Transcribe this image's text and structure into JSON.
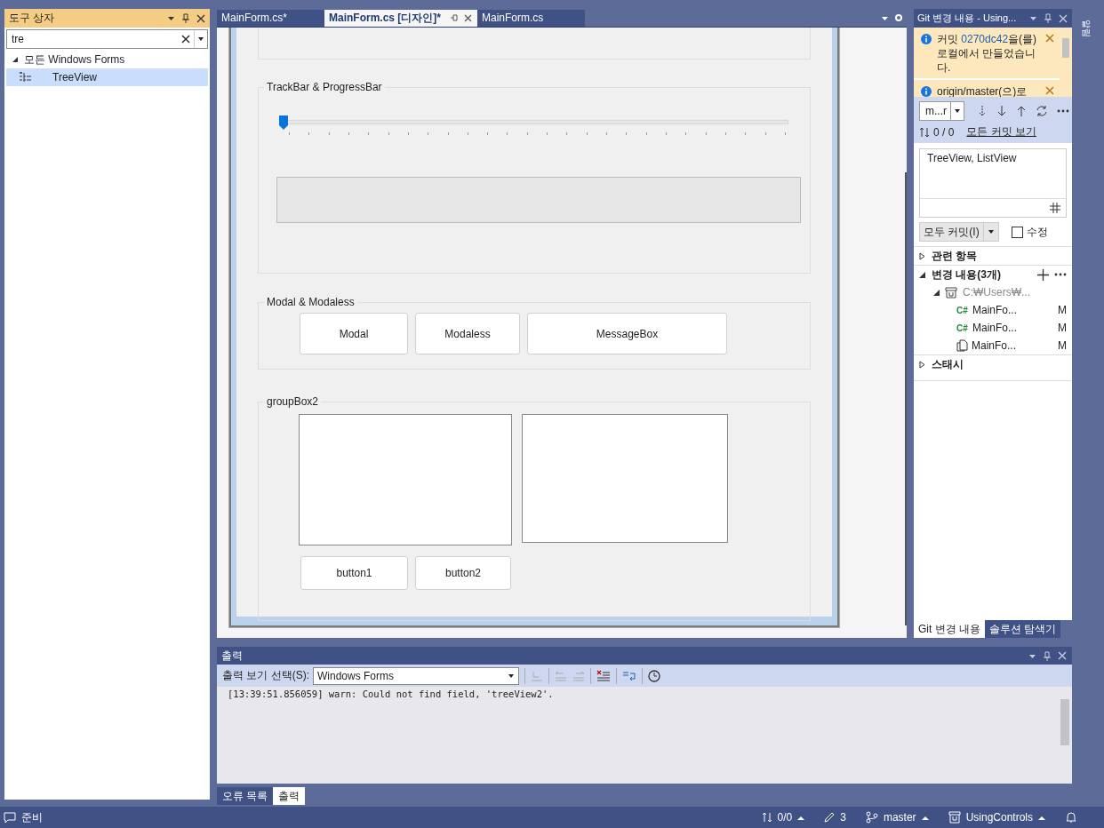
{
  "toolbox": {
    "title": "도구 상자",
    "search": {
      "value": "tre"
    },
    "tree": [
      {
        "label": "모든 Windows Forms",
        "expanded": true,
        "selected": false,
        "children": [
          {
            "label": "TreeView",
            "selected": true
          }
        ]
      }
    ]
  },
  "doc_tabs": [
    {
      "label": "MainForm.cs*",
      "selected": false
    },
    {
      "label": "MainForm.cs [디자인]*",
      "selected": true
    },
    {
      "label": "MainForm.cs",
      "selected": false
    }
  ],
  "designer": {
    "groups": [
      {
        "kind": "blank"
      },
      {
        "kind": "trackbar",
        "title": "TrackBar & ProgressBar",
        "trackbar": {
          "level": 0
        },
        "progress": {
          "level": 0
        }
      },
      {
        "kind": "buttons",
        "title": "Modal & Modaless",
        "buttons": [
          "Modal",
          "Modaless",
          "MessageBox"
        ]
      },
      {
        "kind": "lists",
        "title": "groupBox2",
        "buttons": [
          "button1",
          "button2"
        ]
      }
    ]
  },
  "git": {
    "title": "Git 변경 내용 - Using...",
    "notifications": [
      {
        "before": "커밋 ",
        "link": "0270dc42",
        "after": "을(를) 로컬에서 만들었습니다."
      },
      {
        "before": "origin/master(으)로"
      }
    ],
    "branch": "m...r",
    "counts": "0 / 0",
    "all_commits": "모든 커밋 보기",
    "message": "TreeView, ListView",
    "commit_button": "모두 커밋(I)",
    "amend": {
      "label": "수정",
      "checked": false
    },
    "sections": [
      {
        "label": "관련 항목",
        "expanded": false
      },
      {
        "label": "변경 내용(3개)",
        "expanded": true,
        "children": [
          {
            "label": "C:₩Users₩...",
            "expanded": true,
            "children": [
              {
                "kind": "csharp",
                "icon": "C#",
                "label": "MainFo...",
                "status": "M"
              },
              {
                "kind": "csharp",
                "icon": "C#",
                "label": "MainFo...",
                "status": "M"
              },
              {
                "kind": "file",
                "label": "MainFo...",
                "status": "M"
              }
            ]
          }
        ]
      },
      {
        "label": "스태시",
        "expanded": false
      }
    ],
    "tabs": [
      {
        "label": "Git 변경 내용",
        "selected": true
      },
      {
        "label": "솔루션 탐색기",
        "selected": false
      }
    ]
  },
  "side_strip": {
    "label": "알림"
  },
  "output": {
    "title": "출력",
    "source_label": "출력 보기 선택(S):",
    "source": "Windows Forms",
    "lines": [
      "[13:39:51.856059] warn: Could not find field, 'treeView2'."
    ],
    "tabs": [
      {
        "label": "오류 목록",
        "selected": false
      },
      {
        "label": "출력",
        "selected": true
      }
    ]
  },
  "status_bar": {
    "text": "준비",
    "sync": "0/0",
    "edits": "3",
    "branch": "master",
    "repo": "UsingControls"
  }
}
